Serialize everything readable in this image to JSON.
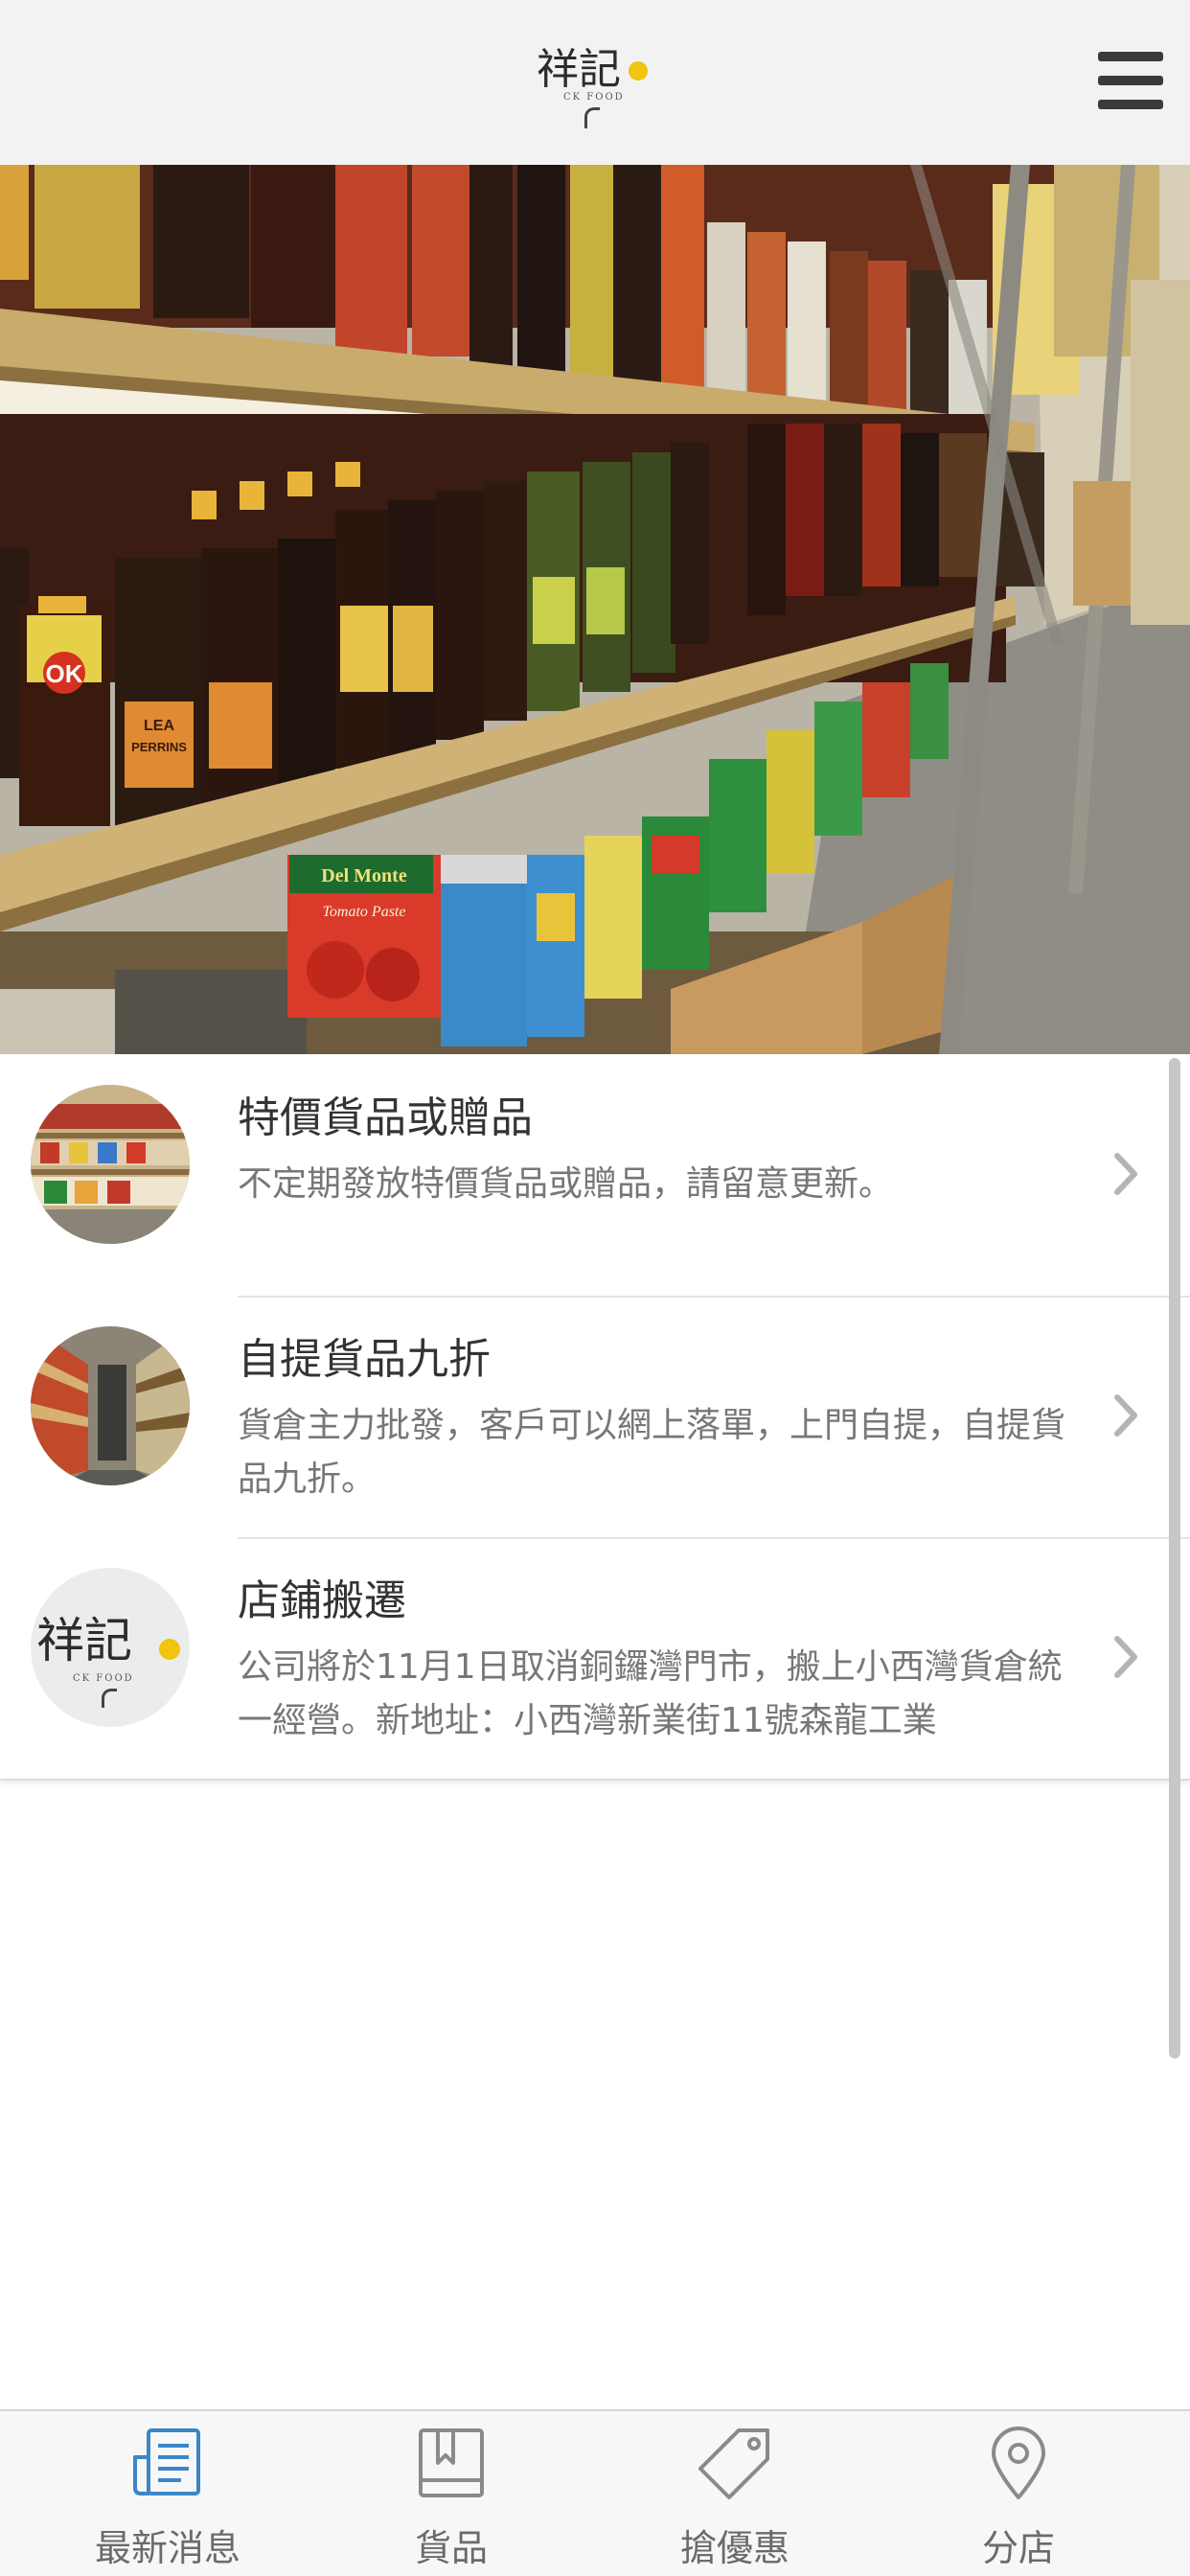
{
  "header": {
    "logo_text": "祥記",
    "logo_subtext": "CK FOOD",
    "menu_icon": "hamburger-menu-icon"
  },
  "hero": {
    "image_subject": "grocery store shelves with sauce bottles and canned goods",
    "label_ok": "OK",
    "label_lea": "LEA",
    "label_perrins": "PERRINS",
    "label_delmonte": "Del Monte",
    "label_tomato": "Tomato Paste"
  },
  "news": {
    "items": [
      {
        "title": "特價貨品或贈品",
        "description": "不定期發放特價貨品或贈品，請留意更新。"
      },
      {
        "title": "自提貨品九折",
        "description": "貨倉主力批發，客戶可以網上落單，上門自提，自提貨品九折。"
      },
      {
        "title": "店鋪搬遷",
        "description": "公司將於11月1日取消銅鑼灣門市，搬上小西灣貨倉統一經營。新地址：小西灣新業街11號森龍工業",
        "thumb_logo": "祥記",
        "thumb_logo_sub": "CK FOOD"
      }
    ]
  },
  "tabbar": {
    "tabs": [
      {
        "label": "最新消息",
        "icon": "newspaper-icon",
        "active": true
      },
      {
        "label": "貨品",
        "icon": "book-icon",
        "active": false
      },
      {
        "label": "搶優惠",
        "icon": "price-tag-icon",
        "active": false
      },
      {
        "label": "分店",
        "icon": "map-pin-icon",
        "active": false
      }
    ]
  },
  "colors": {
    "header_bg": "#f2f2f2",
    "active_icon": "#3b86c6",
    "inactive_icon": "#8a8a8a",
    "title_text": "#333333",
    "desc_text": "#777777"
  }
}
